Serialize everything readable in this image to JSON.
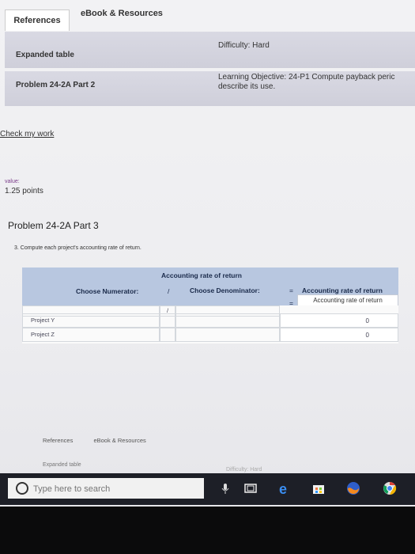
{
  "tabs": {
    "references": "References",
    "ebook": "eBook & Resources"
  },
  "bar1": {
    "left": "Expanded table",
    "right": "Difficulty: Hard"
  },
  "bar2": {
    "left": "Problem 24-2A Part 2",
    "right_line1": "Learning Objective: 24-P1 Compute payback peric",
    "right_line2": "describe its use."
  },
  "check_my_work": "Check my work",
  "value": {
    "label": "value:",
    "points": "1.25 points"
  },
  "problem_title": "Problem 24-2A Part 3",
  "instruction": "3. Compute each project's accounting rate of return.",
  "table": {
    "title": "Accounting rate of return",
    "numerator_header": "Choose Numerator:",
    "slash": "/",
    "denominator_header": "Choose Denominator:",
    "equals": "=",
    "result_header": "Accounting rate of return",
    "result_subheader": "Accounting rate of return",
    "rows": [
      {
        "label": "Project Y",
        "result": "0"
      },
      {
        "label": "Project Z",
        "result": "0"
      }
    ]
  },
  "bottom": {
    "references": "References",
    "ebook": "eBook & Resources",
    "expanded": "Expanded table",
    "difficulty": "Difficulty: Hard"
  },
  "taskbar": {
    "search_placeholder": "Type here to search"
  }
}
